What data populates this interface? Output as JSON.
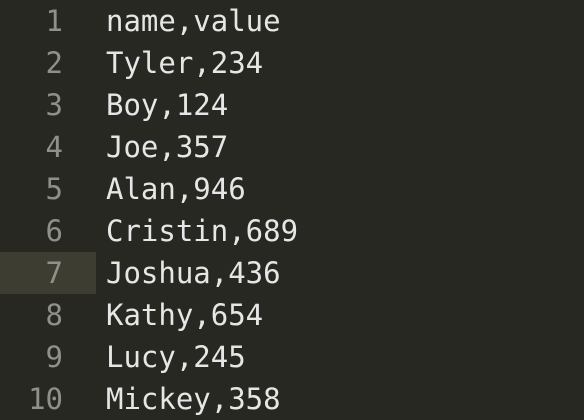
{
  "editor": {
    "active_line": 7,
    "colors": {
      "background": "#272822",
      "active_line_gutter": "#3e3d32",
      "line_number": "#8f908a",
      "text": "#e6e6e6"
    },
    "lines": [
      {
        "number": "1",
        "text": "name,value"
      },
      {
        "number": "2",
        "text": "Tyler,234"
      },
      {
        "number": "3",
        "text": "Boy,124"
      },
      {
        "number": "4",
        "text": "Joe,357"
      },
      {
        "number": "5",
        "text": "Alan,946"
      },
      {
        "number": "6",
        "text": "Cristin,689"
      },
      {
        "number": "7",
        "text": "Joshua,436"
      },
      {
        "number": "8",
        "text": "Kathy,654"
      },
      {
        "number": "9",
        "text": "Lucy,245"
      },
      {
        "number": "10",
        "text": "Mickey,358"
      }
    ]
  }
}
